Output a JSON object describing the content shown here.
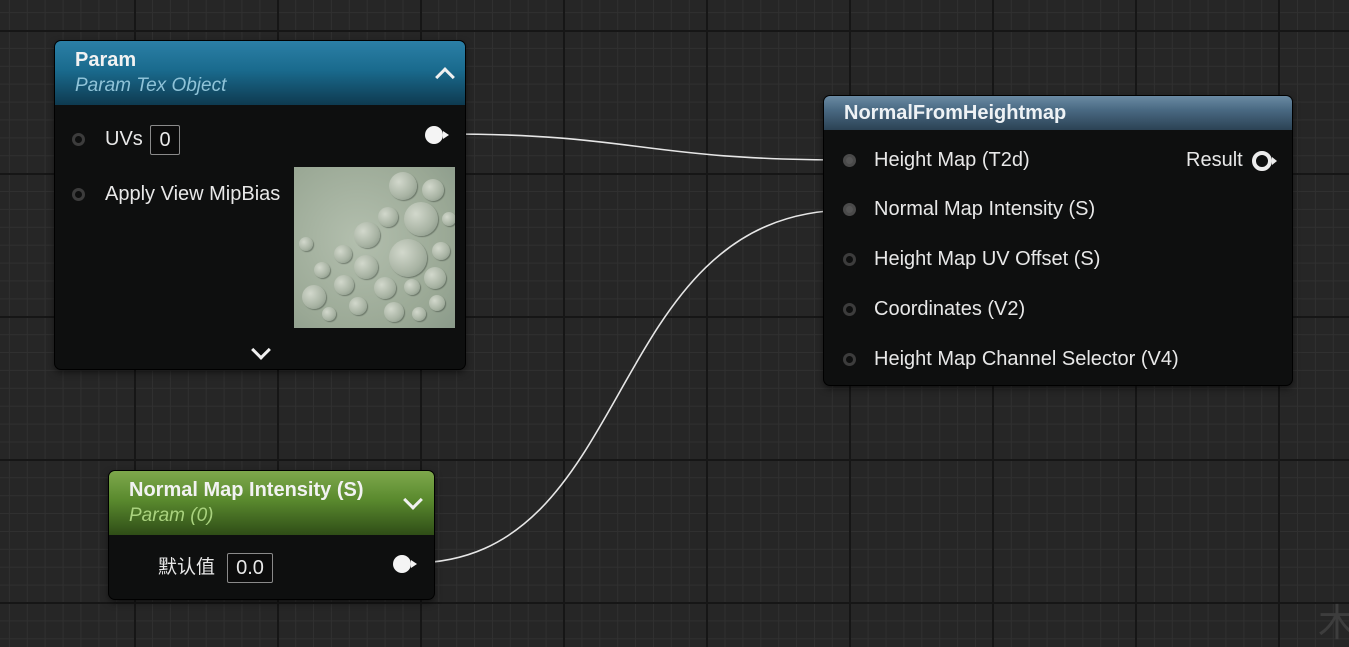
{
  "param_node": {
    "title": "Param",
    "subtitle": "Param Tex Object",
    "header_color": "#1a6b8e",
    "uvs_label": "UVs",
    "uvs_value": "0",
    "mipbias_label": "Apply View MipBias"
  },
  "normal_node": {
    "title": "NormalFromHeightmap",
    "header_color": "#3d5a70",
    "inputs": [
      "Height Map (T2d)",
      "Normal Map Intensity (S)",
      "Height Map UV Offset (S)",
      "Coordinates (V2)",
      "Height Map Channel Selector (V4)"
    ],
    "output_label": "Result"
  },
  "intensity_node": {
    "title": "Normal Map Intensity (S)",
    "subtitle": "Param (0)",
    "header_color": "#4e7d26",
    "default_label": "默认值",
    "default_value": "0.0"
  },
  "watermark": "木"
}
